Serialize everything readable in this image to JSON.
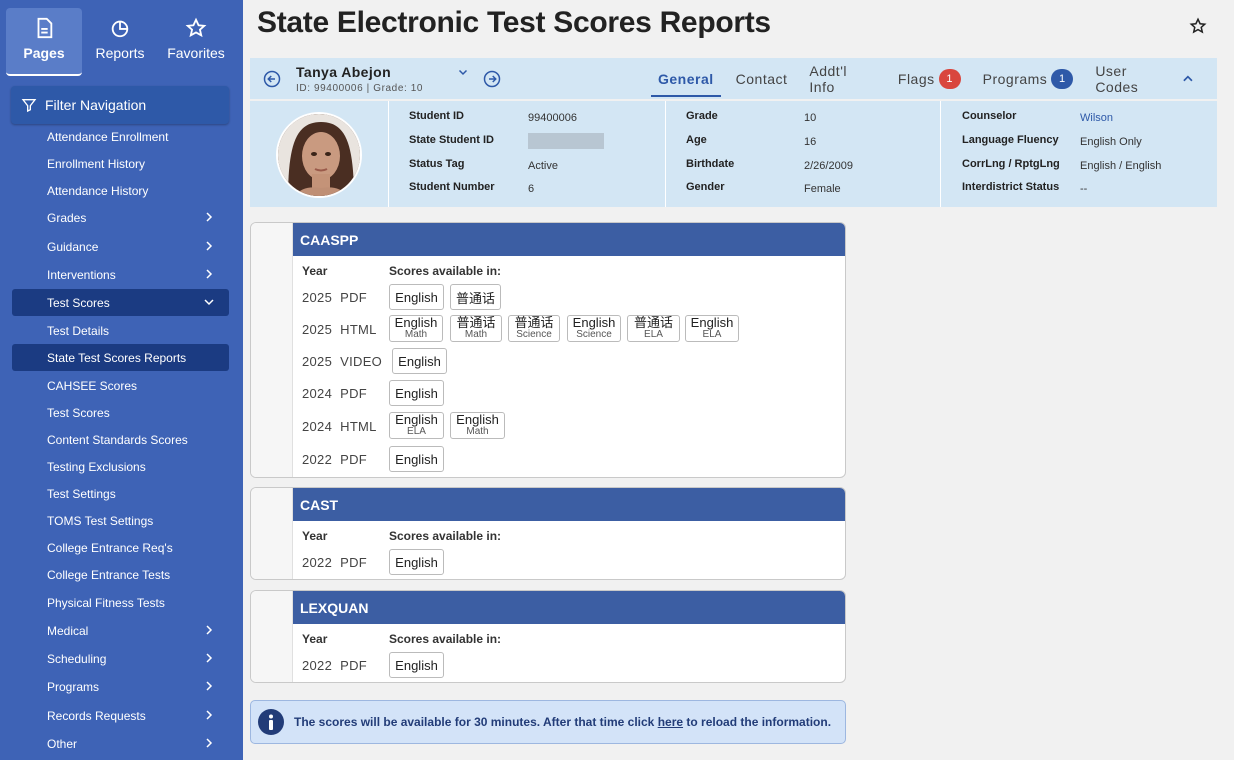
{
  "topnav": {
    "pages": "Pages",
    "reports": "Reports",
    "favorites": "Favorites"
  },
  "filter_nav": "Filter Navigation",
  "menu": [
    {
      "label": "Attendance Enrollment",
      "chevron": false
    },
    {
      "label": "Enrollment History",
      "chevron": false
    },
    {
      "label": "Attendance History",
      "chevron": false
    },
    {
      "label": "Grades",
      "chevron": true
    },
    {
      "label": "Guidance",
      "chevron": true
    },
    {
      "label": "Interventions",
      "chevron": true
    },
    {
      "label": "Test Scores",
      "chevron": true,
      "expanded": true
    },
    {
      "label": "Test Details",
      "chevron": false
    },
    {
      "label": "State Test Scores Reports",
      "chevron": false,
      "selected": true
    },
    {
      "label": "CAHSEE Scores",
      "chevron": false
    },
    {
      "label": "Test Scores",
      "chevron": false
    },
    {
      "label": "Content Standards Scores",
      "chevron": false
    },
    {
      "label": "Testing Exclusions",
      "chevron": false
    },
    {
      "label": "Test Settings",
      "chevron": false
    },
    {
      "label": "TOMS Test Settings",
      "chevron": false
    },
    {
      "label": "College Entrance Req's",
      "chevron": false
    },
    {
      "label": "College Entrance Tests",
      "chevron": false
    },
    {
      "label": "Physical Fitness Tests",
      "chevron": false
    },
    {
      "label": "Medical",
      "chevron": true
    },
    {
      "label": "Scheduling",
      "chevron": true
    },
    {
      "label": "Programs",
      "chevron": true
    },
    {
      "label": "Records Requests",
      "chevron": true
    },
    {
      "label": "Other",
      "chevron": true
    }
  ],
  "page_title": "State Electronic Test Scores Reports",
  "student": {
    "name": "Tanya Abejon",
    "sub": "ID: 99400006 |  Grade: 10"
  },
  "tabs": {
    "general": "General",
    "contact": "Contact",
    "addtl": "Addt'l Info",
    "flags": "Flags",
    "flags_count": "1",
    "programs": "Programs",
    "programs_count": "1",
    "user_codes": "User Codes"
  },
  "info": {
    "c1": [
      [
        "Student ID",
        "99400006"
      ],
      [
        "State Student ID",
        ""
      ],
      [
        "Status Tag",
        "Active"
      ],
      [
        "Student Number",
        "6"
      ]
    ],
    "c2": [
      [
        "Grade",
        "10"
      ],
      [
        "Age",
        "16"
      ],
      [
        "Birthdate",
        "2/26/2009"
      ],
      [
        "Gender",
        "Female"
      ]
    ],
    "c3": [
      [
        "Counselor",
        "Wilson"
      ],
      [
        "Language Fluency",
        "English Only"
      ],
      [
        "CorrLng / RptgLng",
        "English / English"
      ],
      [
        "Interdistrict Status",
        "--"
      ]
    ]
  },
  "cards": {
    "year_header": "Year",
    "avail_header": "Scores available in:",
    "caaspp": {
      "title": "CAASPP",
      "rows": [
        {
          "year": "2025",
          "format": "PDF",
          "buttons": [
            [
              "English",
              ""
            ],
            [
              "普通话",
              ""
            ]
          ]
        },
        {
          "year": "2025",
          "format": "HTML",
          "buttons": [
            [
              "English",
              "Math"
            ],
            [
              "普通话",
              "Math"
            ],
            [
              "普通话",
              "Science"
            ],
            [
              "English",
              "Science"
            ],
            [
              "普通话",
              "ELA"
            ],
            [
              "English",
              "ELA"
            ]
          ]
        },
        {
          "year": "2025",
          "format": "VIDEO",
          "buttons": [
            [
              "English",
              ""
            ]
          ]
        },
        {
          "year": "2024",
          "format": "PDF",
          "buttons": [
            [
              "English",
              ""
            ]
          ]
        },
        {
          "year": "2024",
          "format": "HTML",
          "buttons": [
            [
              "English",
              "ELA"
            ],
            [
              "English",
              "Math"
            ]
          ]
        },
        {
          "year": "2022",
          "format": "PDF",
          "buttons": [
            [
              "English",
              ""
            ]
          ]
        }
      ]
    },
    "cast": {
      "title": "CAST",
      "rows": [
        {
          "year": "2022",
          "format": "PDF",
          "buttons": [
            [
              "English",
              ""
            ]
          ]
        }
      ]
    },
    "lexquan": {
      "title": "LEXQUAN",
      "rows": [
        {
          "year": "2022",
          "format": "PDF",
          "buttons": [
            [
              "English",
              ""
            ]
          ]
        }
      ]
    }
  },
  "notice": {
    "before": "The scores will be available for 30 minutes. After that time click ",
    "link": "here",
    "after": " to reload the information."
  },
  "colors": {
    "sidebar": "#3e63b6",
    "card_header": "#3c5ea3",
    "panel": "#d3e6f4",
    "flag_badge": "#d9463e",
    "program_badge": "#2e59a8"
  }
}
